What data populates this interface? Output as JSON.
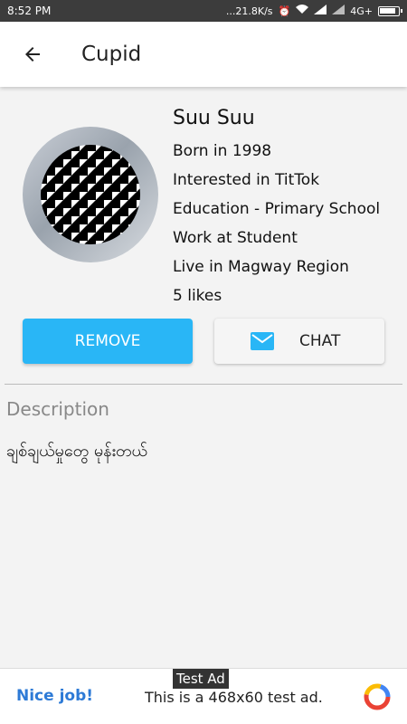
{
  "status_bar": {
    "time": "8:52 PM",
    "network_speed": "...21.8K/s",
    "network_type": "4G+"
  },
  "app_bar": {
    "title": "Cupid",
    "back_icon": "arrow-left-icon"
  },
  "profile": {
    "name": "Suu Suu",
    "details": [
      "Born in 1998",
      "Interested in TitTok",
      "Education - Primary School",
      "Work at Student",
      "Live in Magway Region",
      "5 likes"
    ]
  },
  "actions": {
    "remove_label": "REMOVE",
    "chat_label": "CHAT",
    "remove_color": "#29b6f6",
    "chat_icon": "mail-icon"
  },
  "description": {
    "heading": "Description",
    "text": "ချစ်ချယ်မှုတွေ မုန်းတယ်"
  },
  "ad": {
    "tag": "Test Ad",
    "left_text": "Nice job!",
    "message": "This is a 468x60 test ad."
  }
}
